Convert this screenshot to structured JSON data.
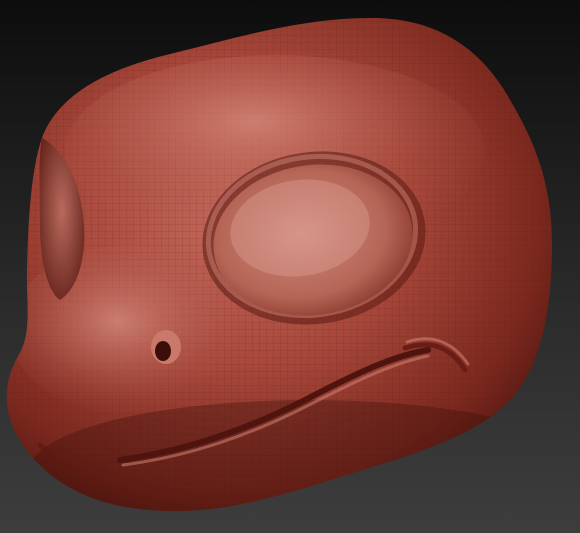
{
  "scene": {
    "subject": "sculpted-creature-head",
    "icons": {
      "head": "head-render",
      "eye": "eye-socket",
      "nostril": "nostril",
      "mouth": "mouth-line"
    },
    "colors": {
      "background_top": "#0d0d0d",
      "background_bottom": "#3d3d3d",
      "clay_light": "#c46a5c",
      "clay_mid": "#9a3a2e",
      "clay_dark": "#4a130d",
      "highlight": "#e7a79a",
      "wire": "#5b1b14"
    }
  }
}
